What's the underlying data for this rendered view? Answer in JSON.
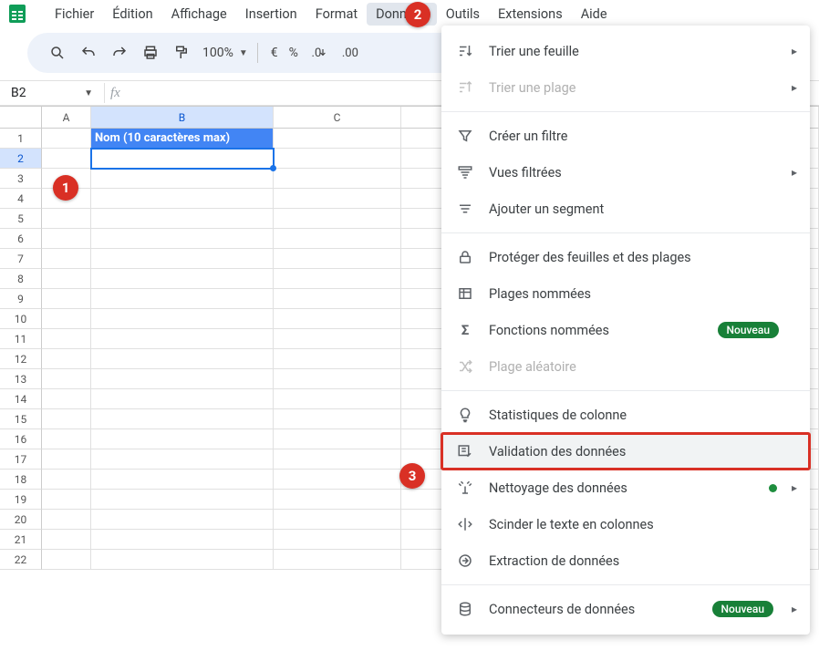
{
  "menubar": {
    "items": [
      "Fichier",
      "Édition",
      "Affichage",
      "Insertion",
      "Format",
      "Données",
      "Outils",
      "Extensions",
      "Aide"
    ],
    "active_index": 5
  },
  "toolbar": {
    "zoom": "100%",
    "currency": "€",
    "percent": "%"
  },
  "namebox": {
    "value": "B2"
  },
  "columns": [
    "A",
    "B",
    "C"
  ],
  "cell_B1": "Nom (10 caractères max)",
  "callouts": {
    "c1": "1",
    "c2": "2",
    "c3": "3"
  },
  "menu": {
    "trier_feuille": "Trier une feuille",
    "trier_plage": "Trier une plage",
    "creer_filtre": "Créer un filtre",
    "vues_filtrees": "Vues filtrées",
    "ajouter_segment": "Ajouter un segment",
    "proteger": "Protéger des feuilles et des plages",
    "plages_nommees": "Plages nommées",
    "fonctions_nommees": "Fonctions nommées",
    "plage_aleatoire": "Plage aléatoire",
    "stats_colonne": "Statistiques de colonne",
    "validation": "Validation des données",
    "nettoyage": "Nettoyage des données",
    "scinder": "Scinder le texte en colonnes",
    "extraction": "Extraction de données",
    "connecteurs": "Connecteurs de données",
    "badge": "Nouveau"
  },
  "row_count": 22
}
